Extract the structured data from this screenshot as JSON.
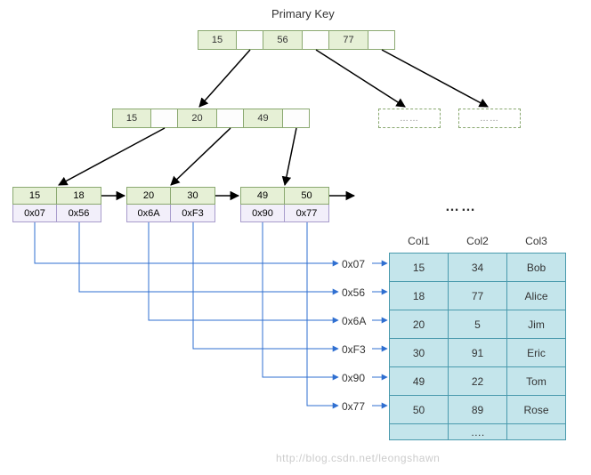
{
  "title": "Primary Key",
  "root": {
    "keys": [
      "15",
      "56",
      "77"
    ]
  },
  "internal": {
    "keys": [
      "15",
      "20",
      "49"
    ]
  },
  "dashed_label": "……",
  "leaves": [
    {
      "keys": [
        "15",
        "18"
      ],
      "ptrs": [
        "0x07",
        "0x56"
      ]
    },
    {
      "keys": [
        "20",
        "30"
      ],
      "ptrs": [
        "0x6A",
        "0xF3"
      ]
    },
    {
      "keys": [
        "49",
        "50"
      ],
      "ptrs": [
        "0x90",
        "0x77"
      ]
    }
  ],
  "leaf_ellipsis": "……",
  "pointer_labels": [
    "0x07",
    "0x56",
    "0x6A",
    "0xF3",
    "0x90",
    "0x77"
  ],
  "table": {
    "headers": [
      "Col1",
      "Col2",
      "Col3"
    ],
    "rows": [
      [
        "15",
        "34",
        "Bob"
      ],
      [
        "18",
        "77",
        "Alice"
      ],
      [
        "20",
        "5",
        "Jim"
      ],
      [
        "30",
        "91",
        "Eric"
      ],
      [
        "49",
        "22",
        "Tom"
      ],
      [
        "50",
        "89",
        "Rose"
      ]
    ],
    "ellipsis": "…."
  },
  "watermark": "http://blog.csdn.net/leongshawn",
  "chart_data": {
    "type": "diagram",
    "description": "B+ tree primary key index diagram",
    "root_node": [
      "15",
      "56",
      "77"
    ],
    "internal_node": [
      "15",
      "20",
      "49"
    ],
    "leaf_nodes": [
      {
        "keys": [
          15,
          18
        ],
        "pointers": [
          "0x07",
          "0x56"
        ]
      },
      {
        "keys": [
          20,
          30
        ],
        "pointers": [
          "0x6A",
          "0xF3"
        ]
      },
      {
        "keys": [
          49,
          50
        ],
        "pointers": [
          "0x90",
          "0x77"
        ]
      }
    ],
    "data_rows": [
      {
        "ptr": "0x07",
        "Col1": 15,
        "Col2": 34,
        "Col3": "Bob"
      },
      {
        "ptr": "0x56",
        "Col1": 18,
        "Col2": 77,
        "Col3": "Alice"
      },
      {
        "ptr": "0x6A",
        "Col1": 20,
        "Col2": 5,
        "Col3": "Jim"
      },
      {
        "ptr": "0xF3",
        "Col1": 30,
        "Col2": 91,
        "Col3": "Eric"
      },
      {
        "ptr": "0x90",
        "Col1": 49,
        "Col2": 22,
        "Col3": "Tom"
      },
      {
        "ptr": "0x77",
        "Col1": 50,
        "Col2": 89,
        "Col3": "Rose"
      }
    ]
  }
}
